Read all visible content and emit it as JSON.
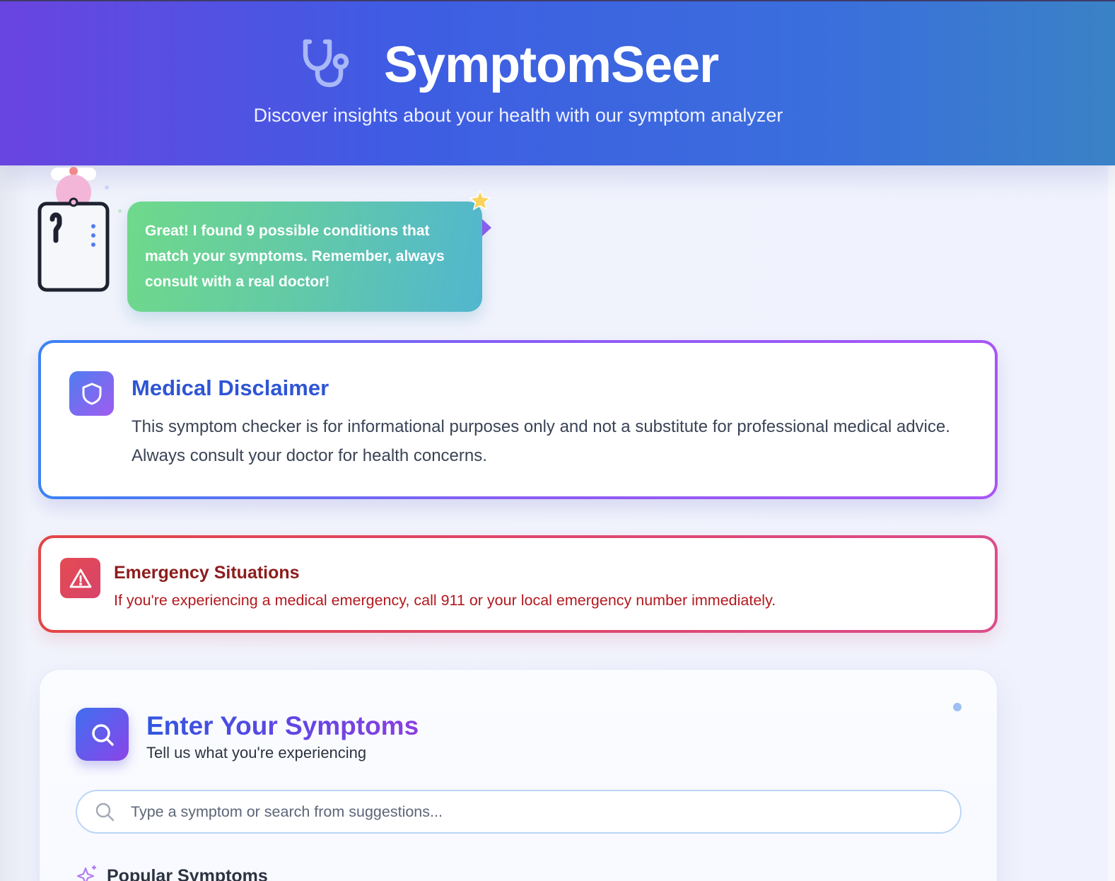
{
  "header": {
    "title": "SymptomSeer",
    "subtitle": "Discover insights about your health with our symptom analyzer",
    "icon": "stethoscope-icon",
    "gradient_start": "#6a44e0",
    "gradient_end": "#3a82c6"
  },
  "assistant": {
    "message": "Great! I found 9 possible conditions that match your symptoms. Remember, always consult with a real doctor!",
    "bubble_color_start": "#6fd98a",
    "bubble_color_end": "#52b6cf"
  },
  "disclaimer": {
    "icon": "shield-icon",
    "title": "Medical Disclaimer",
    "body": "This symptom checker is for informational purposes only and not a substitute for professional medical advice. Always consult your doctor for health concerns.",
    "accent": "#2f55d4"
  },
  "emergency": {
    "icon": "warning-icon",
    "title": "Emergency Situations",
    "body": "If you're experiencing a medical emergency, call 911 or your local emergency number immediately.",
    "accent": "#b3181e"
  },
  "symptoms": {
    "icon": "search-icon",
    "title": "Enter Your Symptoms",
    "subtitle": "Tell us what you're experiencing",
    "search": {
      "value": "",
      "placeholder": "Type a symptom or search from suggestions..."
    },
    "popular_label": "Popular Symptoms",
    "popular_icon": "sparkle-icon"
  }
}
